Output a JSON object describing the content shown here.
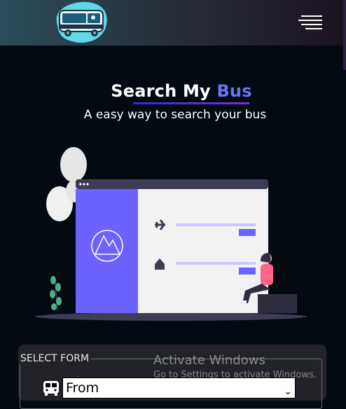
{
  "header": {
    "logo_icon": "bus-logo-icon",
    "menu_icon": "hamburger-menu-icon"
  },
  "hero": {
    "title_prefix": "Search My ",
    "title_highlight": "Bus",
    "subtitle": "A easy way to search your bus"
  },
  "illustration": {
    "icons": [
      "airplane-icon",
      "home-icon",
      "mountain-image-icon"
    ]
  },
  "form": {
    "legend": "SELECT FORM",
    "from_select": {
      "value": "From",
      "icon": "bus-icon"
    }
  },
  "watermark": {
    "title": "Activate Windows",
    "subtitle": "Go to Settings to activate Windows."
  },
  "colors": {
    "background": "#030a12",
    "accent": "#6a73f5",
    "illustration_purple": "#6c63ff"
  }
}
